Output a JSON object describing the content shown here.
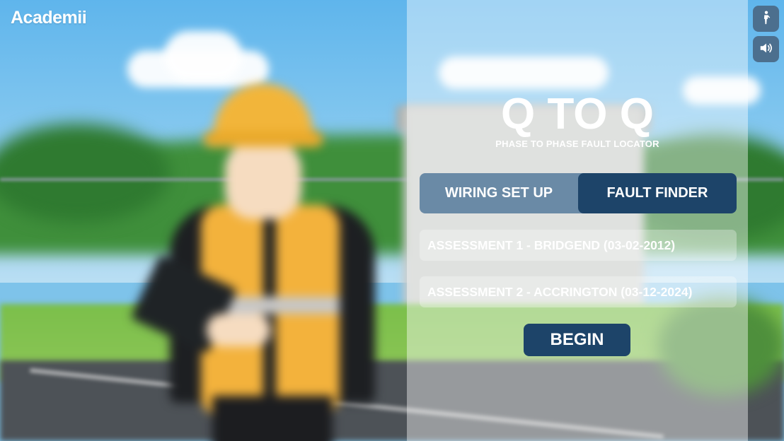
{
  "brand": {
    "logo_text": "Academii"
  },
  "accessibility": {
    "icon": "accessibility-person-icon"
  },
  "sound": {
    "icon": "speaker-volume-icon"
  },
  "app": {
    "title": "Q TO Q",
    "subtitle": "PHASE TO PHASE FAULT LOCATOR"
  },
  "mode_toggle": {
    "options": [
      {
        "label": "WIRING SET UP",
        "selected": false
      },
      {
        "label": "FAULT FINDER",
        "selected": true
      }
    ]
  },
  "assessments": [
    {
      "label": "ASSESSMENT 1 - BRIDGEND (03-02-2012)"
    },
    {
      "label": "ASSESSMENT 2 - ACCRINGTON (03-12-2024)"
    }
  ],
  "actions": {
    "begin_label": "BEGIN"
  },
  "colors": {
    "primary_navy": "#1d4469",
    "toggle_bg": "#6a8aa6",
    "side_button": "#4c6f8e",
    "text": "#ffffff"
  }
}
